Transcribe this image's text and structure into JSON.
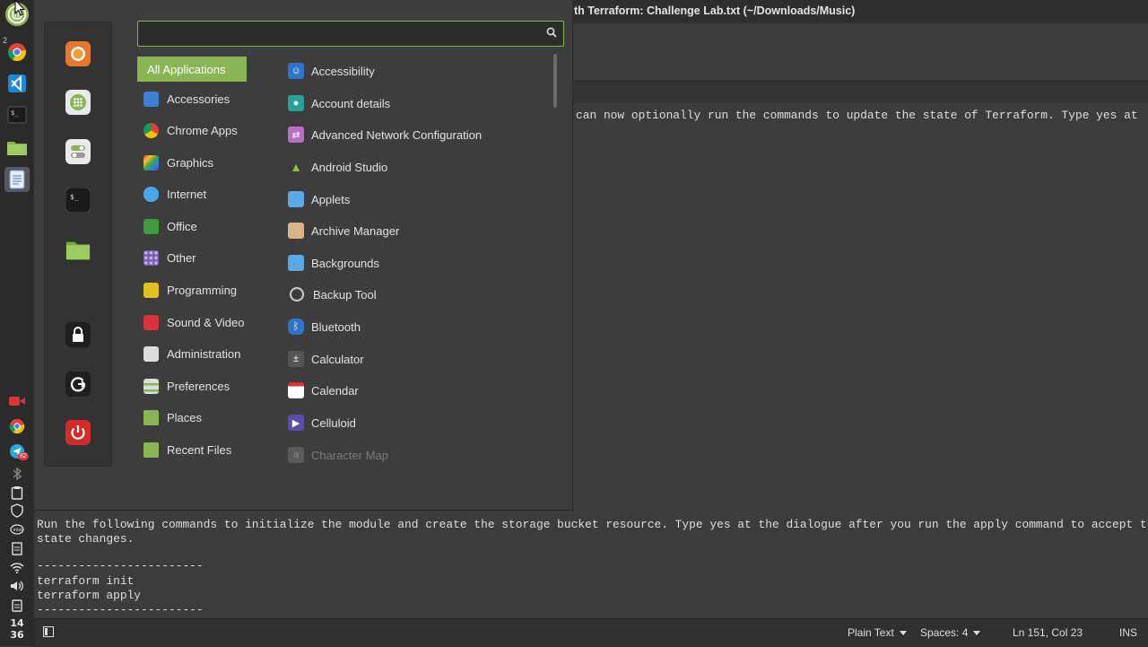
{
  "window": {
    "title": "th Terraform: Challenge Lab.txt (~/Downloads/Music)"
  },
  "editor": {
    "lines": [
      "can now optionally run the commands to update the state of Terraform. Type yes at",
      "Run the following commands to initialize the module and create the storage bucket resource. Type yes at the dialogue after you run the apply command to accept the",
      "state changes.",
      "",
      "------------------------",
      "terraform init",
      "terraform apply",
      "------------------------"
    ]
  },
  "statusbar": {
    "language": "Plain Text",
    "spaces": "Spaces: 4",
    "position": "Ln 151, Col 23",
    "mode": "INS"
  },
  "panel": {
    "workspace_indicator": "2",
    "clock_hour": "14",
    "clock_minute": "36",
    "badge_count": "82"
  },
  "menu": {
    "search": {
      "value": "",
      "placeholder": ""
    },
    "categories": [
      {
        "label": "All Applications",
        "icon": "all-apps-icon",
        "color": "#8ab554"
      },
      {
        "label": "Accessories",
        "icon": "accessories-icon",
        "color": "#3f7fd1"
      },
      {
        "label": "Chrome Apps",
        "icon": "chrome-icon",
        "color": "#d9443a"
      },
      {
        "label": "Graphics",
        "icon": "graphics-icon",
        "color": "#b044c4"
      },
      {
        "label": "Internet",
        "icon": "internet-icon",
        "color": "#4aa6e6"
      },
      {
        "label": "Office",
        "icon": "office-icon",
        "color": "#3d9a3d"
      },
      {
        "label": "Other",
        "icon": "other-icon",
        "color": "#8a6bbf"
      },
      {
        "label": "Programming",
        "icon": "programming-icon",
        "color": "#e0c21f"
      },
      {
        "label": "Sound & Video",
        "icon": "sound-video-icon",
        "color": "#d8323c"
      },
      {
        "label": "Administration",
        "icon": "administration-icon",
        "color": "#dcdcdc"
      },
      {
        "label": "Preferences",
        "icon": "preferences-icon",
        "color": "#dcdcdc"
      },
      {
        "label": "Places",
        "icon": "folder-icon",
        "color": "#8ab554"
      },
      {
        "label": "Recent Files",
        "icon": "recent-files-icon",
        "color": "#8ab554"
      }
    ],
    "apps": [
      {
        "label": "Accessibility",
        "icon": "accessibility-icon",
        "color": "#2f74c9"
      },
      {
        "label": "Account details",
        "icon": "account-icon",
        "color": "#2aa198"
      },
      {
        "label": "Advanced Network Configuration",
        "icon": "network-icon",
        "color": "#b86fc2"
      },
      {
        "label": "Android Studio",
        "icon": "android-icon",
        "color": "#8fbf3f"
      },
      {
        "label": "Applets",
        "icon": "applets-icon",
        "color": "#5aa9e6"
      },
      {
        "label": "Archive Manager",
        "icon": "archive-icon",
        "color": "#d7b48a"
      },
      {
        "label": "Backgrounds",
        "icon": "backgrounds-icon",
        "color": "#5aa9e6"
      },
      {
        "label": "Backup Tool",
        "icon": "backup-icon",
        "color": "#cfcfcf"
      },
      {
        "label": "Bluetooth",
        "icon": "bluetooth-icon",
        "color": "#2f74c9"
      },
      {
        "label": "Calculator",
        "icon": "calculator-icon",
        "color": "#555555"
      },
      {
        "label": "Calendar",
        "icon": "calendar-icon",
        "color": "#ffffff"
      },
      {
        "label": "Celluloid",
        "icon": "celluloid-icon",
        "color": "#5b4ea8"
      },
      {
        "label": "Character Map",
        "icon": "character-map-icon",
        "color": "#666666"
      }
    ]
  },
  "colors": {
    "accent": "#8ab554",
    "menu_bg": "#3d3d3d",
    "editor_bg": "#3c3c3c",
    "panel_bg": "#2b2b2b"
  }
}
